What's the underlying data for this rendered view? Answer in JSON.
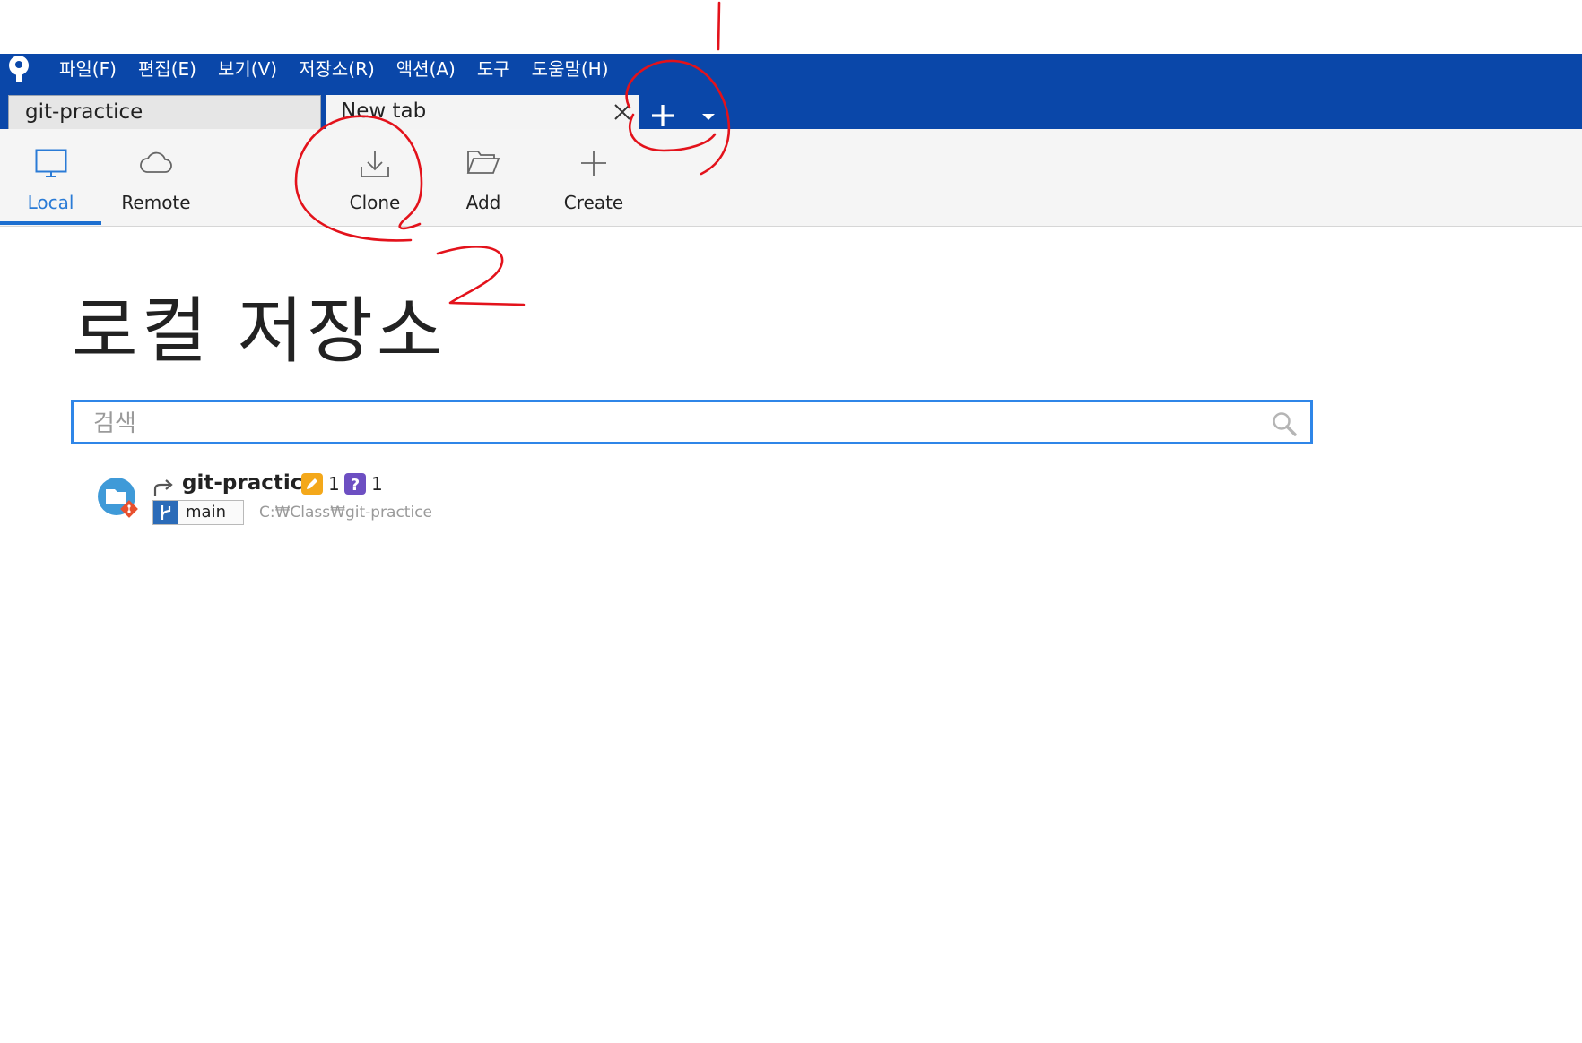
{
  "menubar": {
    "items": [
      "파일(F)",
      "편집(E)",
      "보기(V)",
      "저장소(R)",
      "액션(A)",
      "도구",
      "도움말(H)"
    ]
  },
  "tabs": [
    {
      "label": "git-practice"
    },
    {
      "label": "New tab"
    }
  ],
  "toolbar": {
    "local_label": "Local",
    "remote_label": "Remote",
    "clone_label": "Clone",
    "add_label": "Add",
    "create_label": "Create"
  },
  "main": {
    "title": "로컬 저장소",
    "search": {
      "placeholder": "검색",
      "value": ""
    }
  },
  "repositories": [
    {
      "name": "git-practice",
      "modified_count": "1",
      "untracked_count": "1",
      "branch": "main",
      "path": "C:₩Class₩git-practice"
    }
  ],
  "colors": {
    "menubar": "#0a47a9",
    "accent": "#2f86e8",
    "annotation": "#e3121b"
  }
}
